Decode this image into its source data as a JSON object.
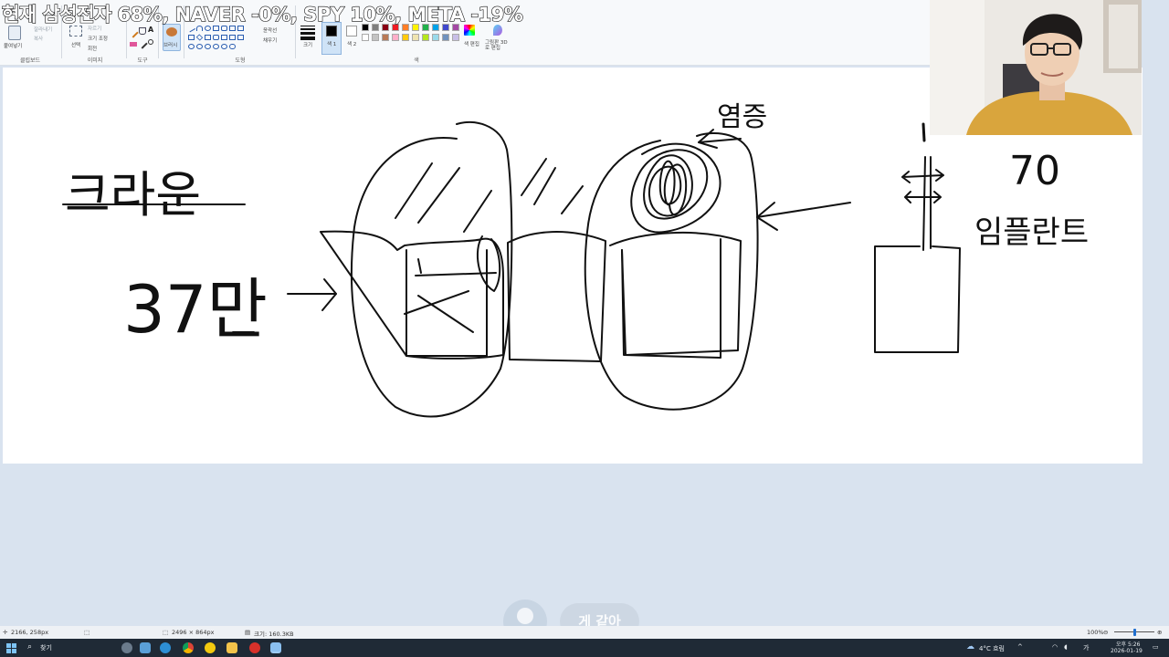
{
  "overlay": {
    "headline": "현재 삼성전자 68%, NAVER -0%, SPY 10%, META -19%"
  },
  "ribbon": {
    "clipboard": {
      "paste": "붙여넣기",
      "cut": "잘라내기",
      "copy": "복사",
      "label": "클립보드"
    },
    "image": {
      "select": "선택",
      "crop": "자르기",
      "resize": "크기 조정",
      "rotate": "회전",
      "label": "이미지"
    },
    "tools": {
      "label": "도구"
    },
    "brushes": {
      "label": "브러시"
    },
    "shapes": {
      "outline": "윤곽선",
      "fill": "채우기",
      "label": "도형"
    },
    "size": {
      "label": "크기"
    },
    "colors": {
      "color1": "색 1",
      "color2": "색 2",
      "edit": "색 편집",
      "paint3d": "그림판 3D로 편집",
      "label": "색",
      "palette_row1": [
        "#000000",
        "#7f7f7f",
        "#880015",
        "#ed1c24",
        "#ff7f27",
        "#fff200",
        "#22b14c",
        "#00a2e8",
        "#3f48cc",
        "#a349a4"
      ],
      "palette_row2": [
        "#ffffff",
        "#c3c3c3",
        "#b97a57",
        "#ffaec9",
        "#ffc90e",
        "#efe4b0",
        "#b5e61d",
        "#99d9ea",
        "#7092be",
        "#c8bfe7"
      ]
    }
  },
  "canvas": {
    "left_word": "크라운",
    "left_price": "37만",
    "inflammation_label": "염증",
    "implant_price": "70",
    "implant_label": "임플란트"
  },
  "chip": {
    "label": "게 같아"
  },
  "statusbar": {
    "cursor": "2166, 258px",
    "canvas_size": "2496 × 864px",
    "file_size": "크기: 160.3KB",
    "zoom": "100%"
  },
  "taskbar": {
    "search": "찾기",
    "weather": "4°C 흐림",
    "time": "오후 5:26",
    "date": "2026-01-19"
  }
}
